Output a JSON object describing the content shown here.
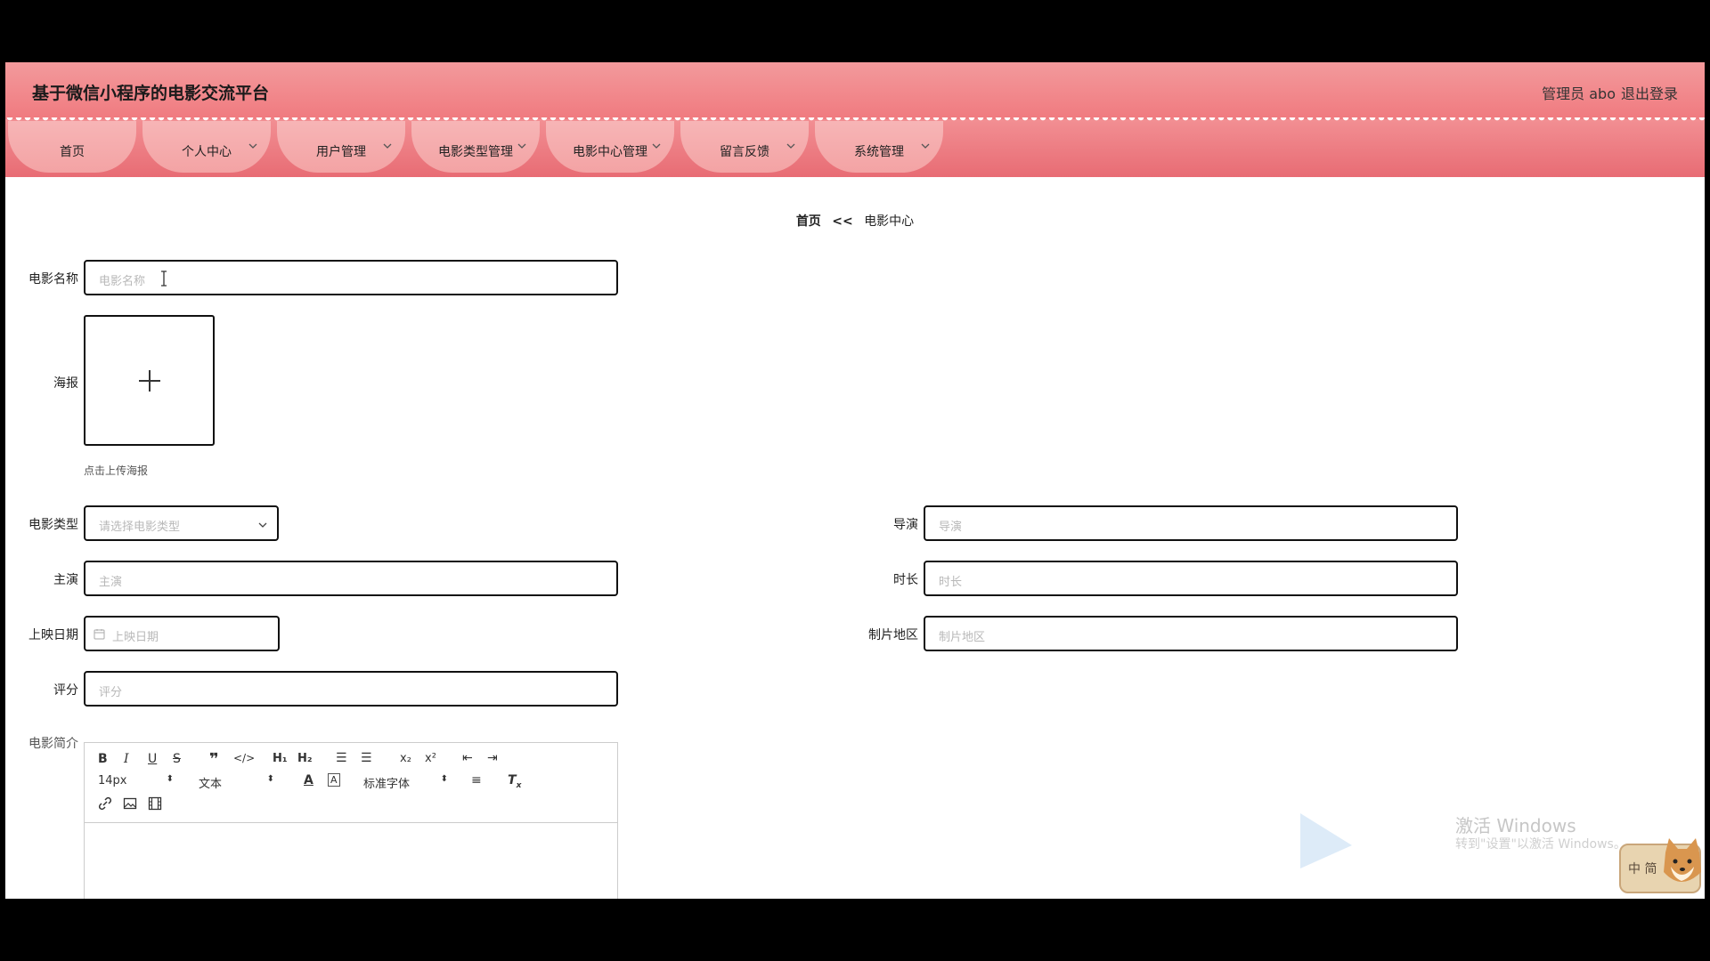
{
  "header": {
    "title": "基于微信小程序的电影交流平台",
    "user": "管理员 abo",
    "logout": "退出登录"
  },
  "nav": [
    {
      "label": "首页",
      "has_menu": false
    },
    {
      "label": "个人中心",
      "has_menu": true
    },
    {
      "label": "用户管理",
      "has_menu": true
    },
    {
      "label": "电影类型管理",
      "has_menu": true
    },
    {
      "label": "电影中心管理",
      "has_menu": true
    },
    {
      "label": "留言反馈",
      "has_menu": true
    },
    {
      "label": "系统管理",
      "has_menu": true
    }
  ],
  "breadcrumb": {
    "home": "首页",
    "sep": "<<",
    "current": "电影中心"
  },
  "form": {
    "name": {
      "label": "电影名称",
      "placeholder": "电影名称"
    },
    "poster": {
      "label": "海报",
      "hint": "点击上传海报"
    },
    "type": {
      "label": "电影类型",
      "placeholder": "请选择电影类型"
    },
    "director": {
      "label": "导演",
      "placeholder": "导演"
    },
    "cast": {
      "label": "主演",
      "placeholder": "主演"
    },
    "duration": {
      "label": "时长",
      "placeholder": "时长"
    },
    "release": {
      "label": "上映日期",
      "placeholder": "上映日期"
    },
    "region": {
      "label": "制片地区",
      "placeholder": "制片地区"
    },
    "score": {
      "label": "评分",
      "placeholder": "评分"
    },
    "intro": {
      "label": "电影简介"
    }
  },
  "editor": {
    "size": "14px",
    "format": "文本",
    "font": "标准字体"
  },
  "watermark": {
    "line1": "激活 Windows",
    "line2": "转到\"设置\"以激活 Windows。",
    "ime": "中 简"
  }
}
